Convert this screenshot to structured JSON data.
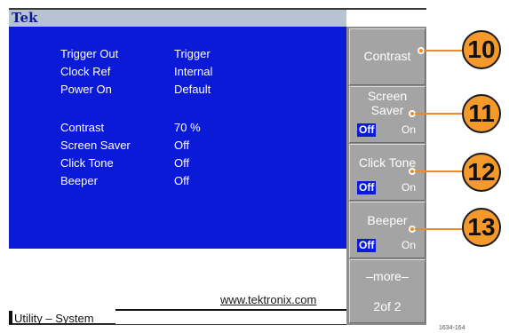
{
  "app": {
    "brand": "Tek"
  },
  "settings": [
    {
      "label": "Trigger Out",
      "value": "Trigger"
    },
    {
      "label": "Clock Ref",
      "value": "Internal"
    },
    {
      "label": "Power On",
      "value": "Default"
    },
    {
      "label": "Contrast",
      "value": "70 %"
    },
    {
      "label": "Screen Saver",
      "value": "Off"
    },
    {
      "label": "Click Tone",
      "value": "Off"
    },
    {
      "label": "Beeper",
      "value": "Off"
    }
  ],
  "footer": {
    "url": "www.tektronix.com",
    "tab": "Utility – System"
  },
  "softkeys": {
    "contrast": {
      "label": "Contrast"
    },
    "screen_saver": {
      "label_line1": "Screen",
      "label_line2": "Saver",
      "off": "Off",
      "on": "On",
      "selected": "Off"
    },
    "click_tone": {
      "label": "Click Tone",
      "off": "Off",
      "on": "On",
      "selected": "Off"
    },
    "beeper": {
      "label": "Beeper",
      "off": "Off",
      "on": "On",
      "selected": "Off"
    },
    "more": {
      "label": "–more–",
      "page": "2of 2"
    }
  },
  "callouts": [
    "10",
    "11",
    "12",
    "13"
  ],
  "figure_id": "1634-164",
  "colors": {
    "screen_blue": "#0b1ad6",
    "softkey_gray": "#a4a4a4",
    "callout_orange": "#f39a2b"
  }
}
